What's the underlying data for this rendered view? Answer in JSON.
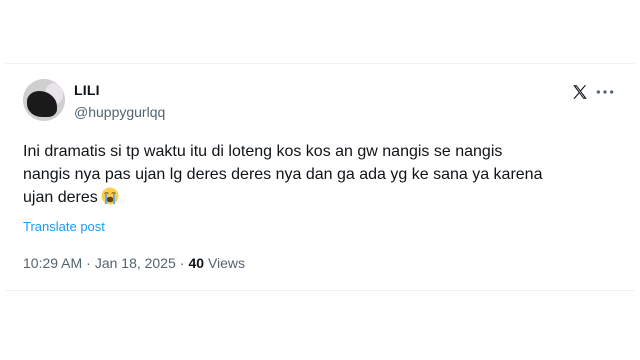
{
  "tweet": {
    "display_name": "LILI",
    "handle": "@huppygurlqq",
    "text_lines": [
      "Ini dramatis si tp waktu itu di loteng kos kos an gw nangis se nangis",
      "nangis nya pas ujan lg deres deres nya dan ga ada yg ke sana ya karena",
      "ujan deres"
    ],
    "emoji_icon": "loudly-crying-face-icon",
    "translate_label": "Translate post",
    "time": "10:29 AM",
    "separator": "·",
    "date": "Jan 18, 2025",
    "views_count": "40",
    "views_label": "Views"
  },
  "icons": {
    "platform": "x-logo-icon",
    "menu": "more-options-icon"
  },
  "colors": {
    "text_primary": "#0f1419",
    "text_secondary": "#536471",
    "link": "#1d9bf0",
    "background": "#ffffff"
  }
}
